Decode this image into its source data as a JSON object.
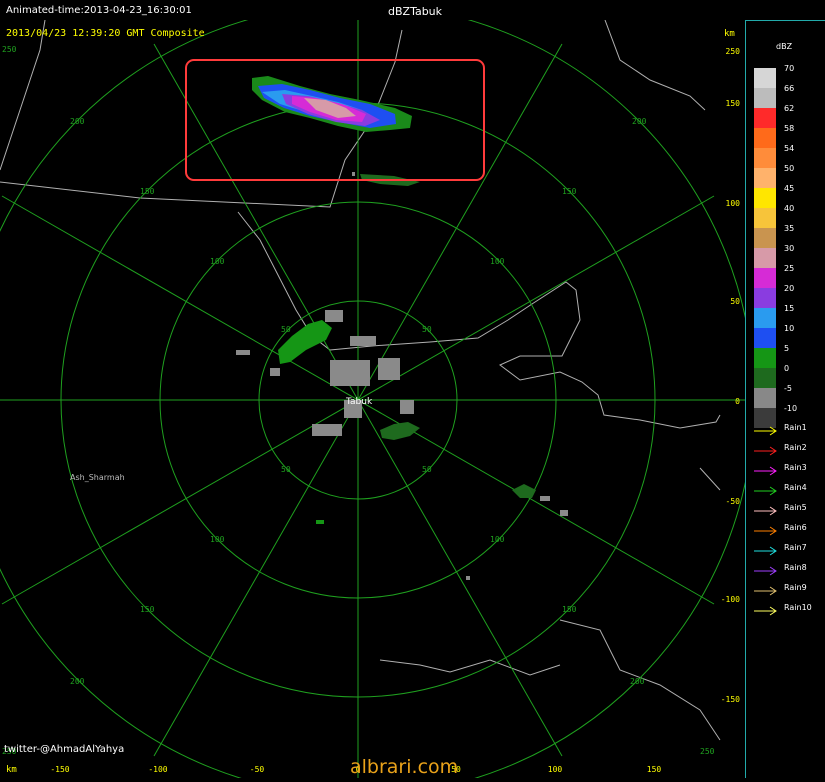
{
  "window": {
    "animated_time": "Animated-time:2013-04-23_16:30:01",
    "title": "dBZTabuk"
  },
  "plot": {
    "header": "2013/04/23 12:39:20 GMT Composite",
    "unit_top": "km",
    "unit_bottom": "km",
    "credit": "twitter-@AhmadAlYahya",
    "city": "Tabuk",
    "place": "Ash_Sharmah",
    "ring_label_values": [
      50,
      100,
      150,
      200,
      250
    ],
    "right_axis_ticks": [
      "250",
      "150",
      "100",
      "50",
      "0",
      "-50",
      "-100",
      "-150"
    ],
    "bottom_axis_ticks": [
      "-150",
      "-100",
      "-50",
      "0",
      "50",
      "100",
      "150"
    ],
    "colors": {
      "grid": "#1fa01f",
      "border": "#b8b8b8",
      "label": "#ffff00",
      "highlight": "#ff3b3b"
    }
  },
  "legend": {
    "unit": "dBZ",
    "scale": [
      {
        "label": "70",
        "color": "#d6d6d6"
      },
      {
        "label": "66",
        "color": "#bcbcbc"
      },
      {
        "label": "62",
        "color": "#ff2a2a"
      },
      {
        "label": "58",
        "color": "#ff6a1a"
      },
      {
        "label": "54",
        "color": "#ff8c3a"
      },
      {
        "label": "50",
        "color": "#ffb26b"
      },
      {
        "label": "45",
        "color": "#ffe600"
      },
      {
        "label": "40",
        "color": "#f7c43a"
      },
      {
        "label": "35",
        "color": "#c9944f"
      },
      {
        "label": "30",
        "color": "#d79aa8"
      },
      {
        "label": "25",
        "color": "#d62bd6"
      },
      {
        "label": "20",
        "color": "#8a3ce0"
      },
      {
        "label": "15",
        "color": "#2a9bef"
      },
      {
        "label": "10",
        "color": "#1e4ff2"
      },
      {
        "label": "5",
        "color": "#159615"
      },
      {
        "label": "0",
        "color": "#1e6a1e"
      },
      {
        "label": "-5",
        "color": "#888888"
      },
      {
        "label": "-10",
        "color": "#3b3b3b"
      }
    ],
    "rain": [
      {
        "label": "Rain1",
        "color": "#ffff00"
      },
      {
        "label": "Rain2",
        "color": "#ff2020"
      },
      {
        "label": "Rain3",
        "color": "#ff20ff"
      },
      {
        "label": "Rain4",
        "color": "#20d020"
      },
      {
        "label": "Rain5",
        "color": "#ffc0c0"
      },
      {
        "label": "Rain6",
        "color": "#ff8000"
      },
      {
        "label": "Rain7",
        "color": "#20e0e0"
      },
      {
        "label": "Rain8",
        "color": "#a040ff"
      },
      {
        "label": "Rain9",
        "color": "#e0c070"
      },
      {
        "label": "Rain10",
        "color": "#ffff60"
      }
    ]
  },
  "watermark": "albrari.com"
}
